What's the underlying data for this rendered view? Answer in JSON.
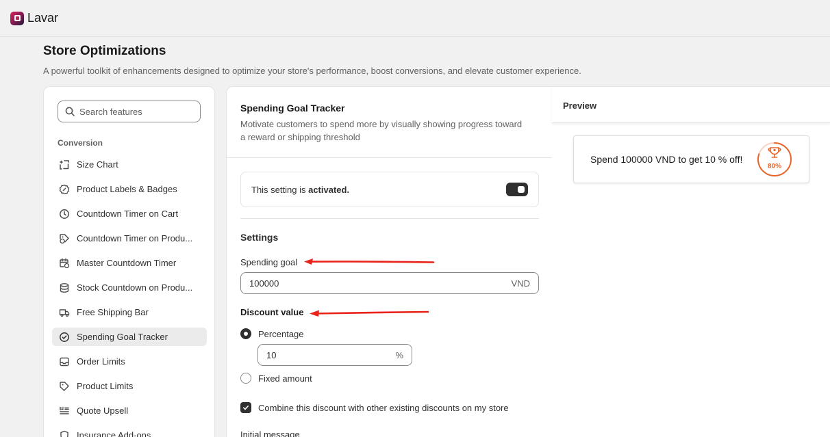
{
  "app": {
    "name": "Lavar"
  },
  "page": {
    "title": "Store Optimizations",
    "subtitle": "A powerful toolkit of enhancements designed to optimize your store's performance, boost conversions, and elevate customer experience."
  },
  "sidebar": {
    "search_placeholder": "Search features",
    "section": "Conversion",
    "items": [
      {
        "label": "Size Chart",
        "icon": "ruler-icon"
      },
      {
        "label": "Product Labels & Badges",
        "icon": "badge-icon"
      },
      {
        "label": "Countdown Timer on Cart",
        "icon": "clock-icon"
      },
      {
        "label": "Countdown Timer on Produ...",
        "icon": "tag-clock-icon"
      },
      {
        "label": "Master Countdown Timer",
        "icon": "calendar-clock-icon"
      },
      {
        "label": "Stock Countdown on Produ...",
        "icon": "database-icon"
      },
      {
        "label": "Free Shipping Bar",
        "icon": "truck-icon"
      },
      {
        "label": "Spending Goal Tracker",
        "icon": "check-circle-icon"
      },
      {
        "label": "Order Limits",
        "icon": "inbox-icon"
      },
      {
        "label": "Product Limits",
        "icon": "tag-icon"
      },
      {
        "label": "Quote Upsell",
        "icon": "list-icon"
      },
      {
        "label": "Insurance Add-ons",
        "icon": "shield-icon"
      }
    ],
    "active_index": 7
  },
  "feature": {
    "title": "Spending Goal Tracker",
    "description": "Motivate customers to spend more by visually showing progress toward a reward or shipping threshold",
    "status_prefix": "This setting is ",
    "status_value": "activated.",
    "activated": true
  },
  "settings": {
    "title": "Settings",
    "spending_goal_label": "Spending goal",
    "spending_goal_value": "100000",
    "spending_goal_suffix": "VND",
    "discount_label": "Discount value",
    "percentage_label": "Percentage",
    "percentage_value": "10",
    "percentage_suffix": "%",
    "fixed_label": "Fixed amount",
    "discount_type": "percentage",
    "combine_label": "Combine this discount with other existing discounts on my store",
    "combine_checked": true,
    "initial_message_label": "Initial message"
  },
  "preview": {
    "title": "Preview",
    "message": "Spend 100000 VND to get 10 % off!",
    "progress_label": "80%",
    "progress": 0.8
  },
  "colors": {
    "accent": "#e8652a",
    "annotation_arrow": "#e8231a",
    "dark": "#303030"
  }
}
